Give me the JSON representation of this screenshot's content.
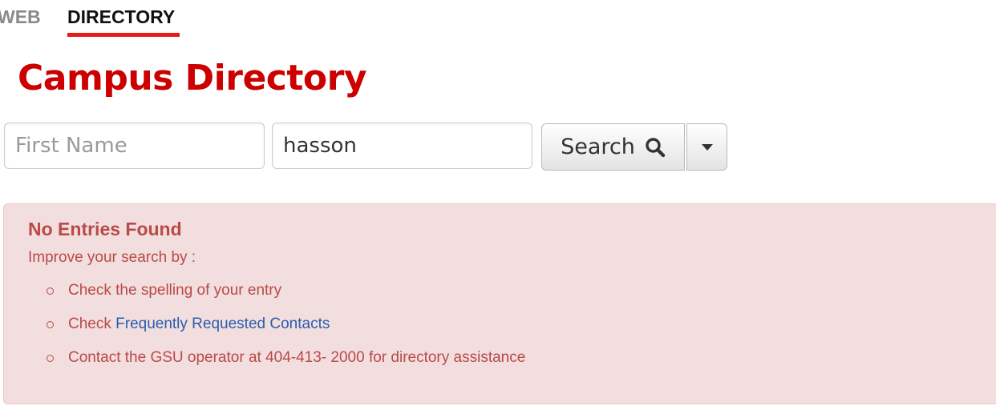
{
  "tabs": {
    "web": "WEB",
    "directory": "DIRECTORY"
  },
  "title": "Campus Directory",
  "search": {
    "first_name_placeholder": "First Name",
    "first_name_value": "",
    "last_name_value": "hasson",
    "button_label": "Search"
  },
  "alert": {
    "heading": "No Entries Found",
    "intro": "Improve your search by :",
    "items": [
      {
        "text": "Check the spelling of your entry"
      },
      {
        "prefix": "Check ",
        "link": "Frequently Requested Contacts"
      },
      {
        "text": "Contact the GSU operator at 404-413- 2000 for directory assistance"
      }
    ]
  },
  "colors": {
    "brand_red": "#cc0000",
    "tab_underline": "#e41b17",
    "alert_bg": "#f2dede",
    "alert_text": "#b94a48",
    "link": "#2a5db0"
  },
  "icons": {
    "search": "magnifier-icon",
    "dropdown": "caret-down-icon"
  }
}
